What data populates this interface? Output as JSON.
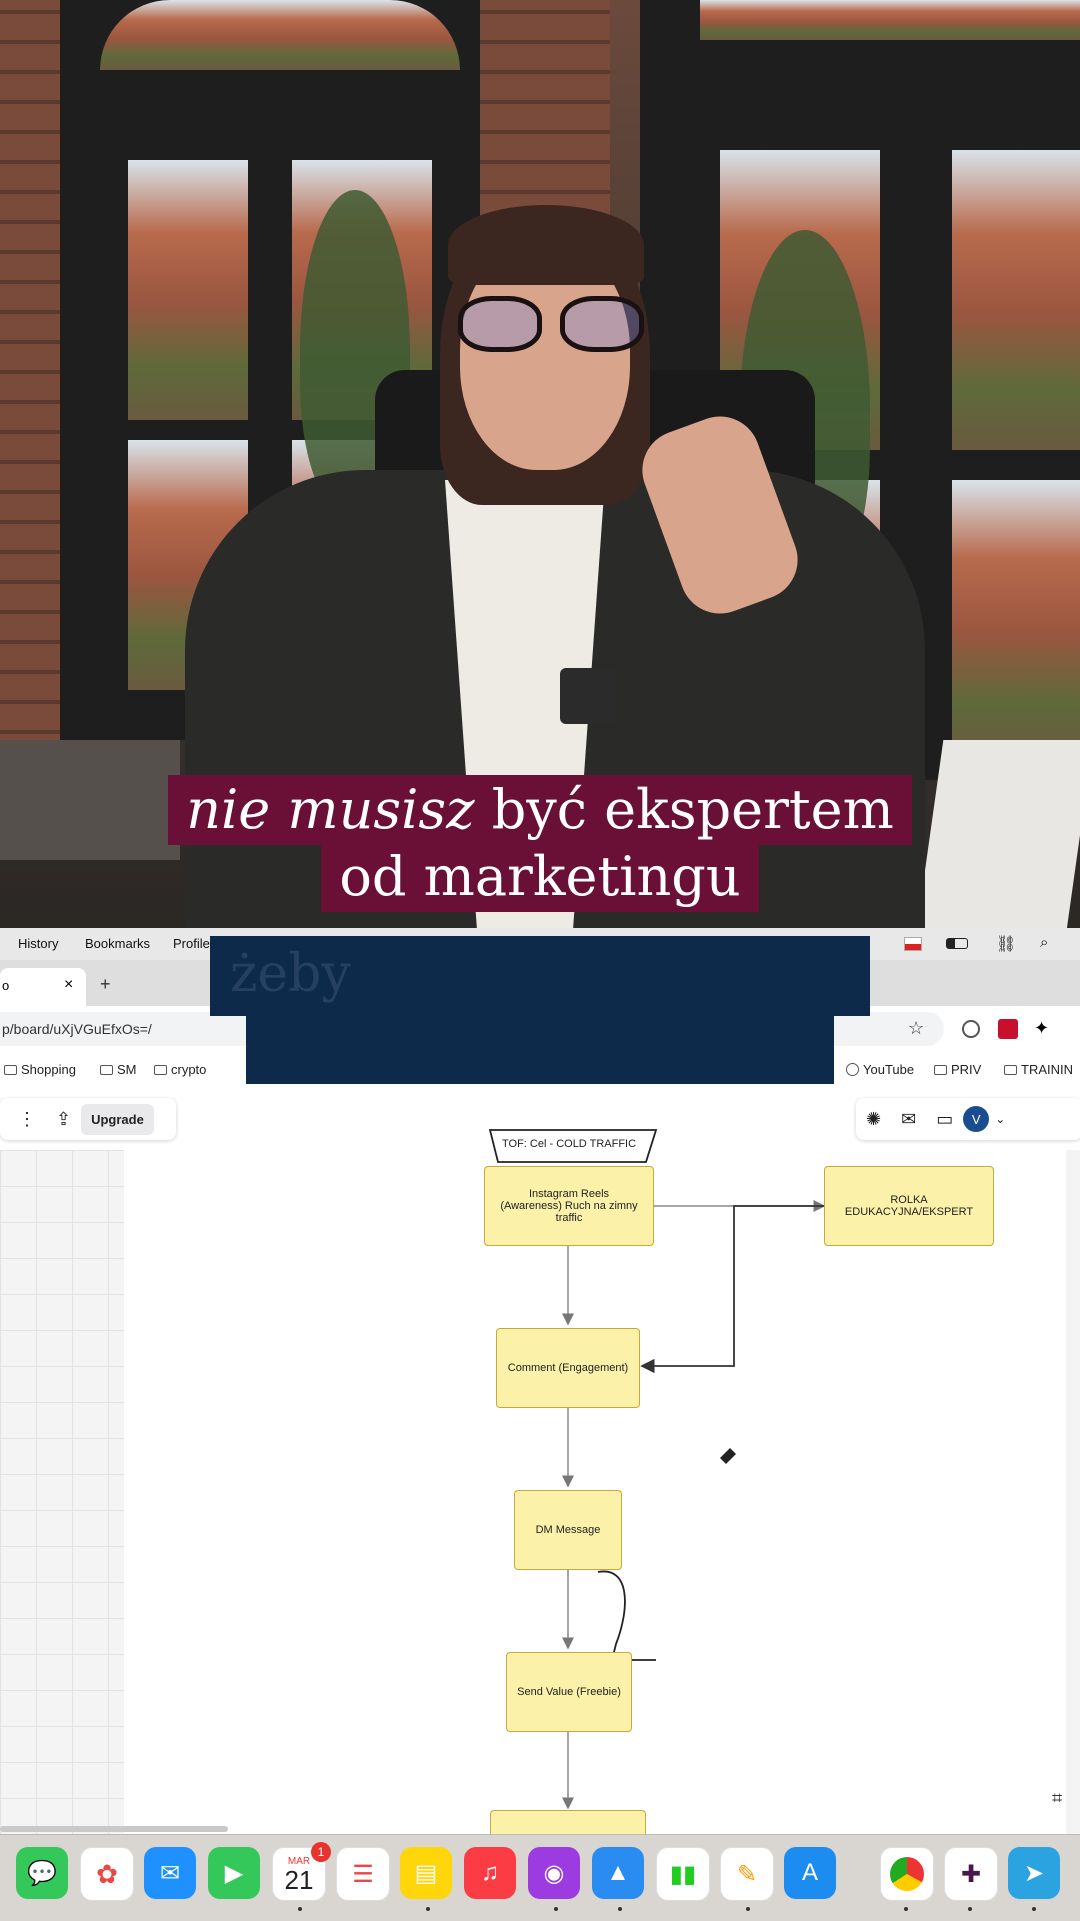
{
  "caption": {
    "line1_italic": "nie musisz",
    "line1_rest": " być ekspertem",
    "line2": "od marketingu",
    "overlay_word": "żeby"
  },
  "menubar": {
    "items": [
      "History",
      "Bookmarks",
      "Profile"
    ]
  },
  "tabs": {
    "active_fragment": "o",
    "close": "×",
    "new": "+"
  },
  "address": {
    "url": "p/board/uXjVGuEfxOs=/",
    "star": "☆"
  },
  "bookmarks": {
    "left": [
      "Shopping",
      "SM",
      "crypto"
    ],
    "right": [
      "YouTube",
      "PRIV",
      "TRAININ"
    ]
  },
  "toolbar": {
    "upgrade_label": "Upgrade",
    "avatar_letter": "V"
  },
  "diagram": {
    "title": "TOF: Cel - COLD TRAFFIC",
    "nodes": {
      "reels": "Instagram Reels (Awareness) Ruch na zimny traffic",
      "rolka": "ROLKA EDUKACYJNA/EKSPERT",
      "comment": "Comment (Engagement)",
      "dm": "DM Message",
      "value": "Send Value (Freebie)"
    }
  },
  "dock": {
    "calendar_month": "MAR",
    "calendar_day": "21",
    "calendar_badge": "1"
  },
  "colors": {
    "caption_bg": "#6a0f36",
    "overlay_bg": "#0d2a4b",
    "node_fill": "#fbf1a9",
    "node_border": "#c7a93a"
  }
}
